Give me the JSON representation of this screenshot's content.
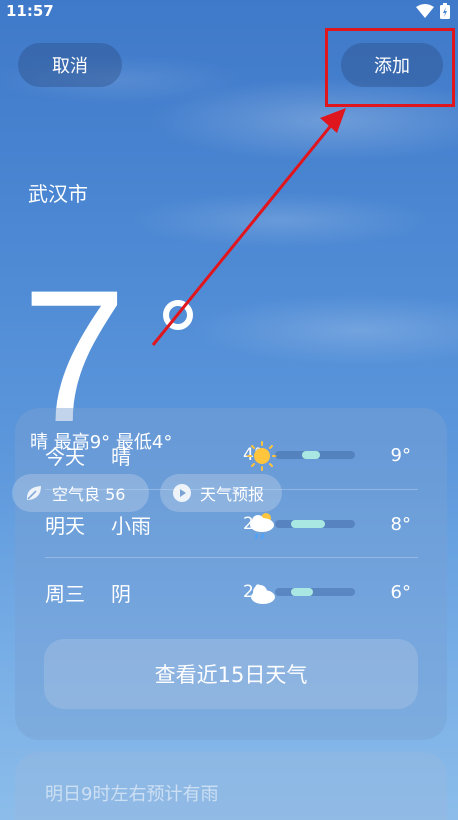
{
  "status_bar": {
    "time": "11:57"
  },
  "header": {
    "cancel_label": "取消",
    "add_label": "添加"
  },
  "city": "武汉市",
  "current": {
    "temp": "7",
    "summary": "晴 最高9° 最低4°"
  },
  "chips": {
    "aqi": "空气良 56",
    "forecast": "天气预报"
  },
  "forecast": [
    {
      "day": "今天",
      "cond": "晴",
      "low": "4°",
      "high": "9°",
      "icon": "sun-icon",
      "bar": [
        0.2,
        0.6
      ]
    },
    {
      "day": "明天",
      "cond": "小雨",
      "low": "2°",
      "high": "8°",
      "icon": "rain-cloud-icon",
      "bar": [
        0.1,
        0.55
      ]
    },
    {
      "day": "周三",
      "cond": "阴",
      "low": "2°",
      "high": "6°",
      "icon": "cloud-icon",
      "bar": [
        0.1,
        0.4
      ]
    }
  ],
  "view15_label": "查看近15日天气",
  "rain_note": "明日9时左右预计有雨",
  "colors": {
    "highlight": "#e0161f",
    "bar_fill": "#a9e7e2"
  }
}
